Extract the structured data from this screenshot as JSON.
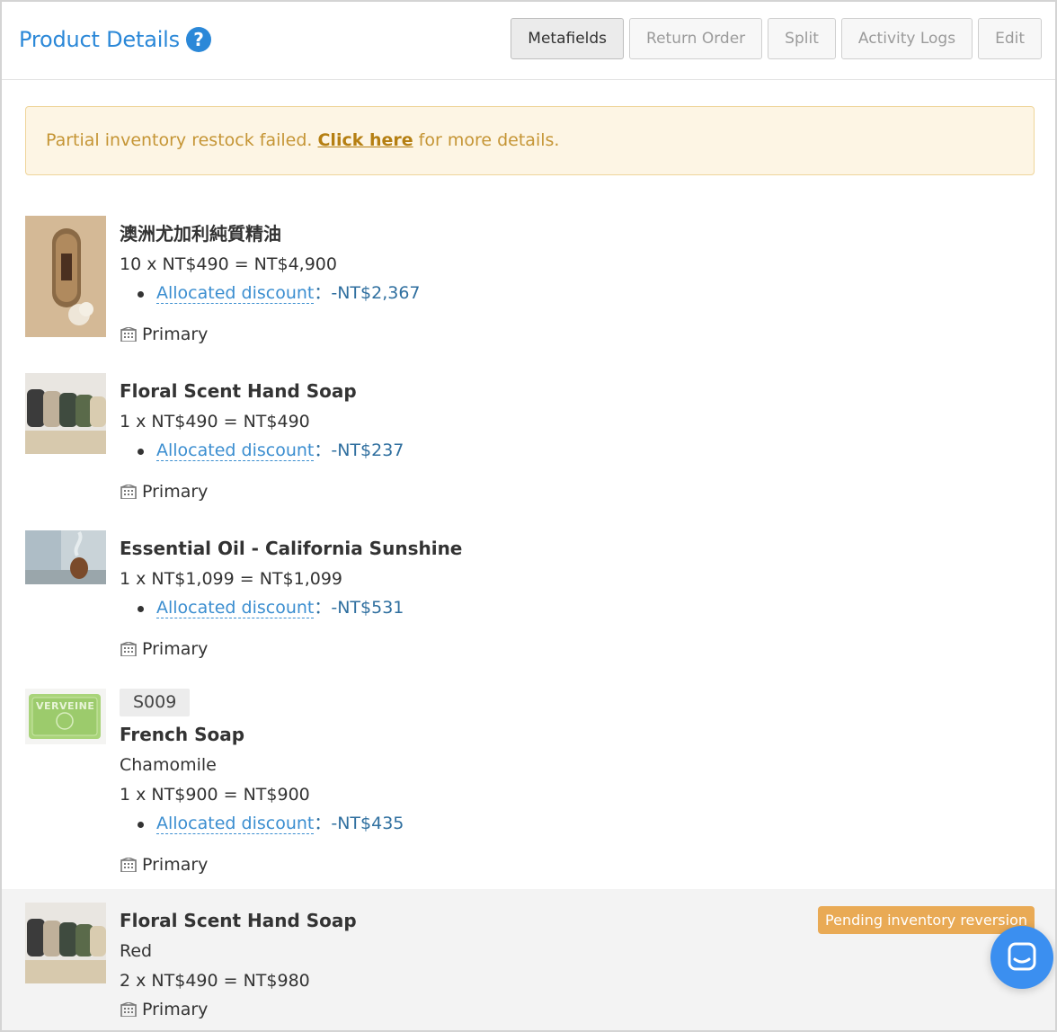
{
  "header": {
    "title": "Product Details",
    "help_icon": "?",
    "buttons": {
      "metafields": "Metafields",
      "return_order": "Return Order",
      "split": "Split",
      "activity_logs": "Activity Logs",
      "edit": "Edit"
    }
  },
  "alert": {
    "before": "Partial inventory restock failed. ",
    "link": "Click here",
    "after": " for more details."
  },
  "items": [
    {
      "name": "澳洲尤加利純質精油",
      "qty_line": "10 x NT$490 = NT$4,900",
      "discount_label": "Allocated discount",
      "discount_value": "：-NT$2,367",
      "location": "Primary"
    },
    {
      "name": "Floral Scent Hand Soap",
      "qty_line": "1 x NT$490 = NT$490",
      "discount_label": "Allocated discount",
      "discount_value": "：-NT$237",
      "location": "Primary"
    },
    {
      "name": "Essential Oil - California Sunshine",
      "qty_line": "1 x NT$1,099 = NT$1,099",
      "discount_label": "Allocated discount",
      "discount_value": "：-NT$531",
      "location": "Primary"
    },
    {
      "sku": "S009",
      "name": "French Soap",
      "variant": "Chamomile",
      "qty_line": "1 x NT$900 = NT$900",
      "discount_label": "Allocated discount",
      "discount_value": "：-NT$435",
      "location": "Primary",
      "thumb_text": "VERVEINE"
    },
    {
      "name": "Floral Scent Hand Soap",
      "variant": "Red",
      "qty_line": "2 x NT$490 = NT$980",
      "location": "Primary",
      "badge": "Pending inventory reversion"
    }
  ],
  "colors": {
    "accent": "#2b88d8",
    "alert_bg": "#fdf5e4",
    "alert_text": "#c59535",
    "badge": "#e9aa55",
    "chat": "#3b8ff0"
  },
  "icons": [
    "help-icon",
    "building-icon",
    "chat-icon"
  ]
}
